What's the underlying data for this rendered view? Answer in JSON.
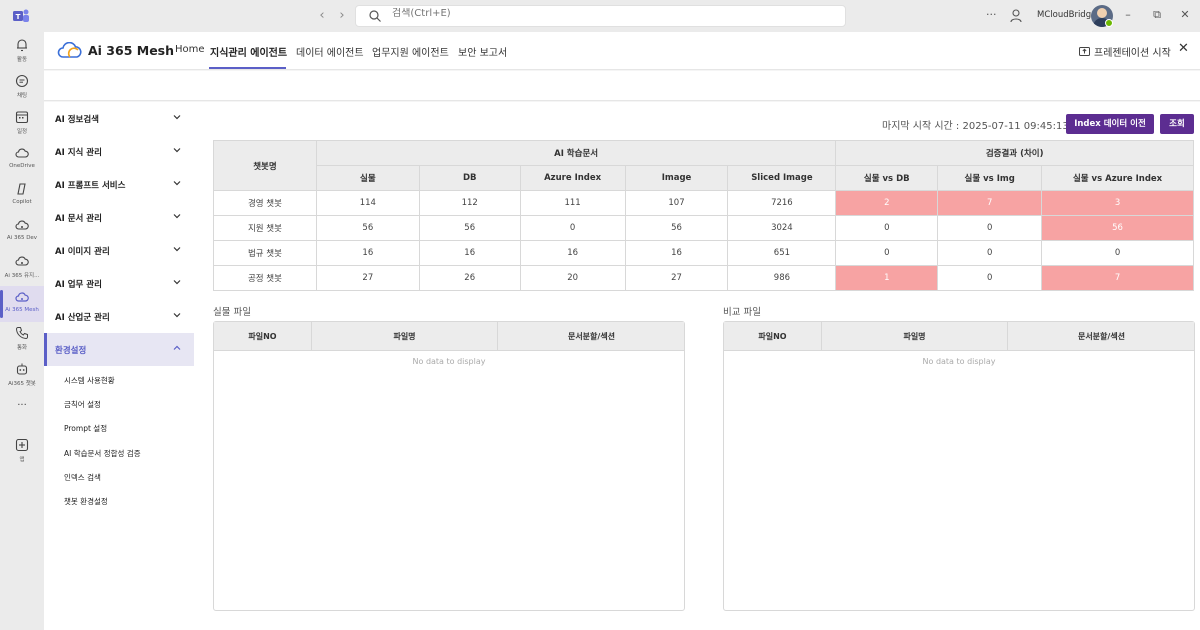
{
  "titlebar": {
    "search_placeholder": "검색(Ctrl+E)",
    "more": "···",
    "user_name": "MCloudBridge",
    "minimize": "–",
    "restore": "⧉",
    "close": "✕"
  },
  "rail": [
    {
      "label": "활동",
      "icon": "bell-icon"
    },
    {
      "label": "채팅",
      "icon": "chat-icon"
    },
    {
      "label": "일정",
      "icon": "calendar-icon"
    },
    {
      "label": "OneDrive",
      "icon": "cloud-icon"
    },
    {
      "label": "Copilot",
      "icon": "copilot-icon"
    },
    {
      "label": "Ai 365 Dev",
      "icon": "app-cloud-icon"
    },
    {
      "label": "Ai 365 유지...",
      "icon": "app-cloud-icon"
    },
    {
      "label": "Ai 365 Mesh",
      "icon": "app-cloud-icon"
    },
    {
      "label": "통화",
      "icon": "phone-icon"
    },
    {
      "label": "Ai365 챗봇",
      "icon": "bot-icon"
    },
    {
      "label": "···",
      "icon": "more-icon"
    },
    {
      "label": "앱",
      "icon": "add-app-icon"
    }
  ],
  "header": {
    "brand": "Ai 365 Mesh",
    "tabs": [
      "Home",
      "지식관리 에이전트",
      "데이터 에이전트",
      "업무지원 에이전트",
      "보안 보고서"
    ],
    "active_tab": 1,
    "present_label": "프레젠테이션 시작",
    "close": "✕"
  },
  "menu": {
    "items": [
      "AI 정보검색",
      "AI 지식 관리",
      "AI 프롬프트 서비스",
      "AI 문서 관리",
      "AI 이미지 관리",
      "AI 업무 관리",
      "AI 산업군 관리",
      "환경설정"
    ],
    "sub_items": [
      "시스템 사용현황",
      "금칙어 설정",
      "Prompt 설정",
      "AI 학습문서 정합성 검증",
      "인덱스 검색",
      "챗봇 환경설정"
    ]
  },
  "main": {
    "timestamp_label": "마지막 시작 시간 : 2025-07-11 09:45:13",
    "btn_index": "Index 데이터 이전",
    "btn_query": "조회",
    "table": {
      "col_bot": "챗봇명",
      "group_ai": "AI 학습문서",
      "group_verify": "검증결과 (차이)",
      "ai_cols": [
        "실물",
        "DB",
        "Azure Index",
        "Image",
        "Sliced Image"
      ],
      "verify_cols": [
        "실물 vs DB",
        "실물 vs Img",
        "실물 vs Azure Index"
      ],
      "rows": [
        {
          "name": "경영 챗봇",
          "vals": [
            "114",
            "112",
            "111",
            "107",
            "7216"
          ],
          "diff": [
            "2",
            "7",
            "3"
          ],
          "hl": [
            true,
            true,
            true
          ]
        },
        {
          "name": "지원 챗봇",
          "vals": [
            "56",
            "56",
            "0",
            "56",
            "3024"
          ],
          "diff": [
            "0",
            "0",
            "56"
          ],
          "hl": [
            false,
            false,
            true
          ]
        },
        {
          "name": "법규 챗봇",
          "vals": [
            "16",
            "16",
            "16",
            "16",
            "651"
          ],
          "diff": [
            "0",
            "0",
            "0"
          ],
          "hl": [
            false,
            false,
            false
          ]
        },
        {
          "name": "공정 챗봇",
          "vals": [
            "27",
            "26",
            "20",
            "27",
            "986"
          ],
          "diff": [
            "1",
            "0",
            "7"
          ],
          "hl": [
            true,
            false,
            true
          ]
        }
      ]
    },
    "left_grid": {
      "title": "실물 파일",
      "cols": [
        "파일NO",
        "파일명",
        "문서분할/섹션"
      ],
      "empty": "No data to display"
    },
    "right_grid": {
      "title": "비교 파일",
      "cols": [
        "파일NO",
        "파일명",
        "문서분할/섹션"
      ],
      "empty": "No data to display"
    }
  },
  "colors": {
    "accent": "#5b5fc7",
    "button": "#5c2d91",
    "highlight": "#f7a3a3"
  }
}
